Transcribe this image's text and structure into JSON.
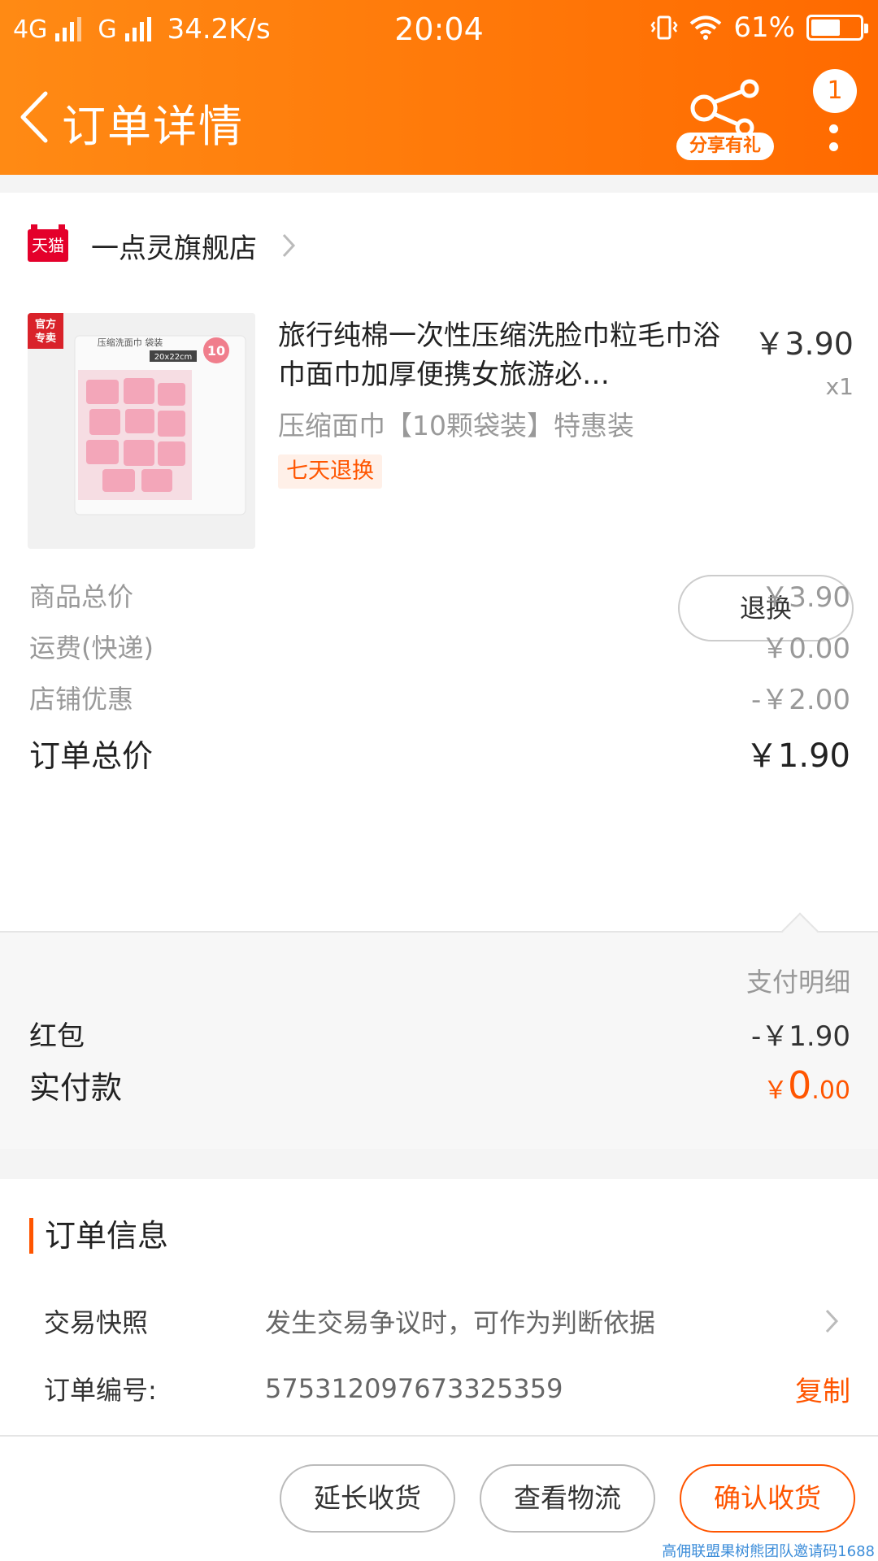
{
  "status_bar": {
    "net1": "4G",
    "net2": "G",
    "speed": "34.2K/s",
    "time": "20:04",
    "battery": "61%",
    "battery_level": 0.61
  },
  "nav": {
    "title": "订单详情",
    "share_label": "分享有礼",
    "badge": "1"
  },
  "shop": {
    "badge": "天猫",
    "name": "一点灵旗舰店"
  },
  "product": {
    "corner_tag": "官方专卖",
    "pack_label": "压缩洗面巾 袋装",
    "pack_size": "20x22cm",
    "pack_count": "10",
    "title": "旅行纯棉一次性压缩洗脸巾粒毛巾浴巾面巾加厚便携女旅游必…",
    "price": "￥3.90",
    "qty": "x1",
    "sku": "压缩面巾【10颗袋装】特惠装",
    "tag": "七天退换",
    "return_button": "退换"
  },
  "summary": {
    "goods_label": "商品总价",
    "goods_value": "￥3.90",
    "shipping_label": "运费(快递)",
    "shipping_value": "￥0.00",
    "discount_label": "店铺优惠",
    "discount_value": "-￥2.00",
    "total_label": "订单总价",
    "total_value": "￥1.90"
  },
  "payment": {
    "detail_link": "支付明细",
    "redpacket_label": "红包",
    "redpacket_value": "-￥1.90",
    "real_label": "实付款",
    "real_currency": "￥",
    "real_int": "0",
    "real_dec": ".00"
  },
  "order_info": {
    "title": "订单信息",
    "snapshot_label": "交易快照",
    "snapshot_value": "发生交易争议时，可作为判断依据",
    "order_no_label": "订单编号:",
    "order_no_value": "575312097673325359",
    "copy": "复制"
  },
  "bottom": {
    "extend": "延长收货",
    "logistics": "查看物流",
    "confirm": "确认收货"
  },
  "watermark": "高佣联盟果树熊团队邀请码1688",
  "colors": {
    "header_start": "#ff8a14",
    "header_end": "#ff6a00",
    "accent": "#ff5500",
    "tmall_red": "#e4002b"
  }
}
